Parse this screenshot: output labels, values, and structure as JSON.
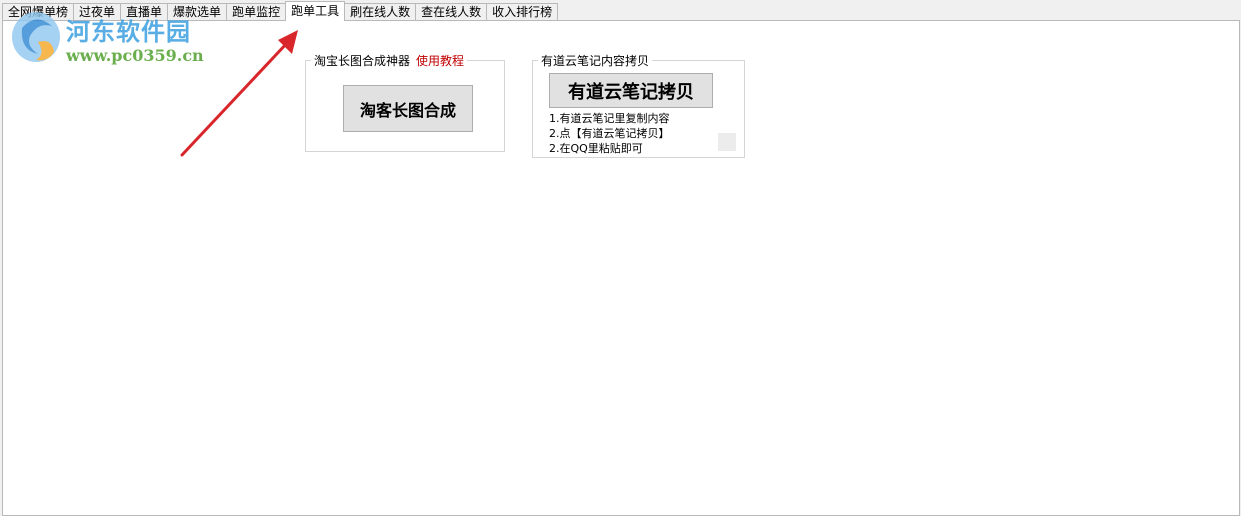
{
  "tabs": [
    {
      "label": "全网爆单榜"
    },
    {
      "label": "过夜单"
    },
    {
      "label": "直播单"
    },
    {
      "label": "爆款选单"
    },
    {
      "label": "跑单监控"
    },
    {
      "label": "跑单工具"
    },
    {
      "label": "刷在线人数"
    },
    {
      "label": "查在线人数"
    },
    {
      "label": "收入排行榜"
    }
  ],
  "active_tab": "跑单工具",
  "taobao_group": {
    "title": "淘宝长图合成神器",
    "tutorial_link": "使用教程",
    "button_label": "淘客长图合成"
  },
  "youdao_group": {
    "title": "有道云笔记内容拷贝",
    "button_label": "有道云笔记拷贝",
    "steps": [
      "1.有道云笔记里复制内容",
      "2.点【有道云笔记拷贝】",
      "2.在QQ里粘贴即可"
    ]
  },
  "watermark": {
    "title": "河东软件园",
    "url": "www.pc0359.cn"
  },
  "colors": {
    "tutorial_link": "#c00000",
    "watermark_title": "#3b9fe0",
    "watermark_url": "#5aa63a",
    "arrow": "#d9262b"
  }
}
